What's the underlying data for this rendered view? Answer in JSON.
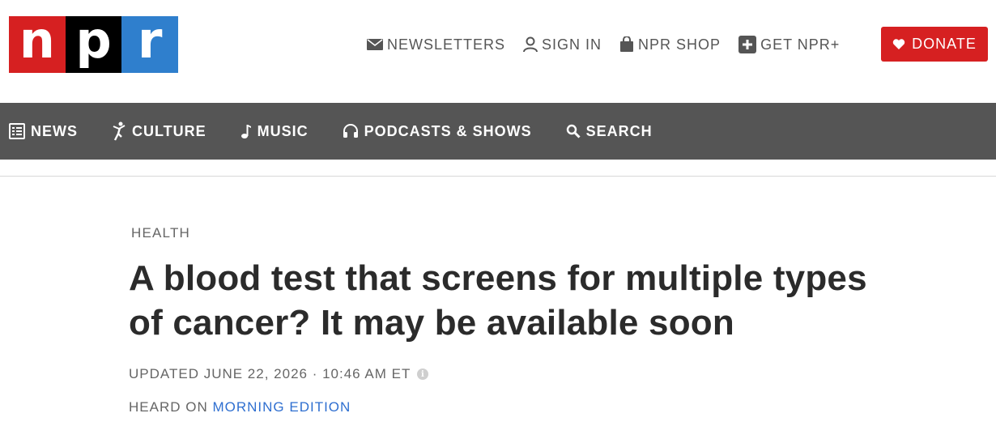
{
  "brand": {
    "logo_letters": [
      "n",
      "p",
      "r"
    ],
    "logo_colors": [
      "#d62021",
      "#000000",
      "#2f7fcd"
    ]
  },
  "utility_nav": [
    {
      "label": "NEWSLETTERS",
      "icon": "envelope-icon"
    },
    {
      "label": "SIGN IN",
      "icon": "user-icon"
    },
    {
      "label": "NPR SHOP",
      "icon": "shopping-bag-icon"
    },
    {
      "label": "GET NPR+",
      "icon": "plus-square-icon"
    }
  ],
  "donate": {
    "label": "DONATE",
    "icon": "heart-icon",
    "color": "#d62021"
  },
  "main_nav": [
    {
      "label": "NEWS",
      "icon": "list-icon"
    },
    {
      "label": "CULTURE",
      "icon": "dancer-icon"
    },
    {
      "label": "MUSIC",
      "icon": "music-note-icon"
    },
    {
      "label": "PODCASTS & SHOWS",
      "icon": "headphones-icon"
    },
    {
      "label": "SEARCH",
      "icon": "search-icon"
    }
  ],
  "nav_color": "#555555",
  "article": {
    "slug": "HEALTH",
    "headline": "A blood test that screens for multiple types of cancer? It may be available soon",
    "dateline": "UPDATED JUNE 22, 2026 · 10:46 AM ET",
    "info_glyph": "i",
    "heard_on_prefix": "HEARD ON ",
    "heard_on_show": "MORNING EDITION",
    "link_color": "#2f6fd0"
  }
}
